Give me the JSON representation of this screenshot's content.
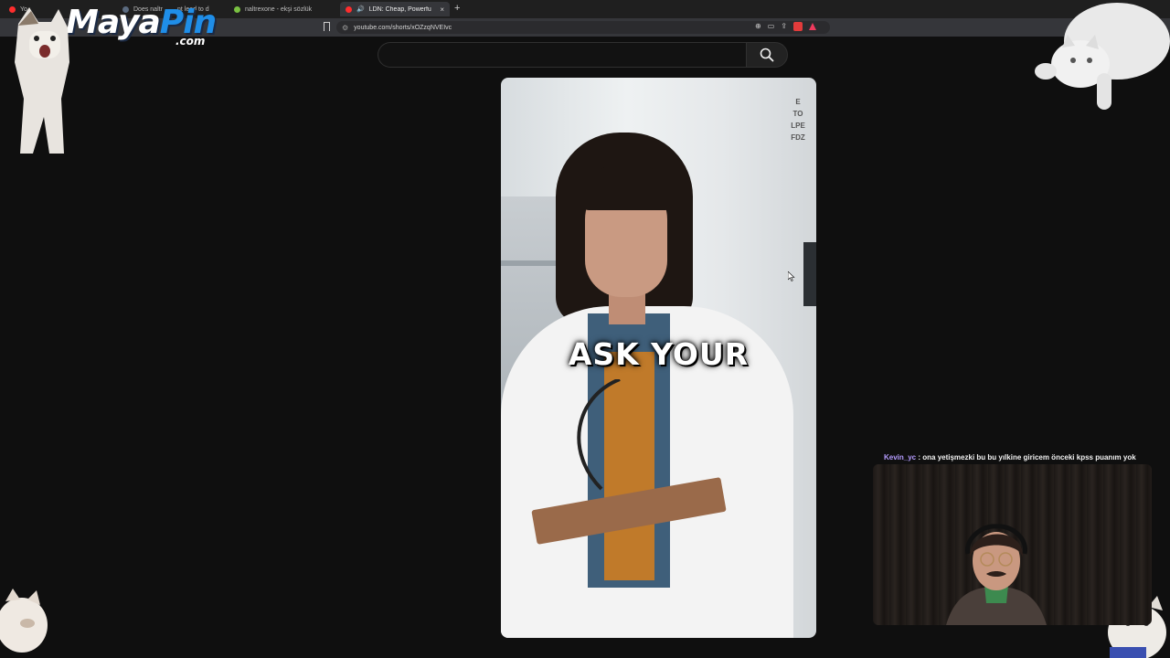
{
  "browser": {
    "tabs": [
      {
        "label": "Yo",
        "favicon_color": "#ff2d2d"
      },
      {
        "label": "Does naltr",
        "favicon_color": "#5b6b80"
      },
      {
        "label": "nt lead to d",
        "favicon_color": "#5b6b80"
      },
      {
        "label": "naltrexone - ekşi sözlük",
        "favicon_color": "#7ac142"
      },
      {
        "label": "LDN: Cheap, Powerful, and O",
        "favicon_color": "#ff2d2d",
        "active": true
      }
    ],
    "active_tab_close": "×",
    "new_tab": "+",
    "url": "youtube.com/shorts/xOZzqNVEIvc"
  },
  "youtube": {
    "search_placeholder": "",
    "search_icon": "search-icon"
  },
  "video": {
    "caption": "ASK YOUR",
    "eyechart_lines": [
      "E",
      "TO",
      "LPE",
      "FDZ"
    ]
  },
  "overlay": {
    "logo_maya": "Maya",
    "logo_pin": "Pin",
    "logo_dotcom": ".com",
    "brand_colors": {
      "primary": "#1f8ee8",
      "white": "#ffffff"
    }
  },
  "chat": {
    "username": "Kevin_yc",
    "separator": " : ",
    "message": "ona yetişmezki bu bu yılkine giricem önceki kpss puanım yok"
  }
}
